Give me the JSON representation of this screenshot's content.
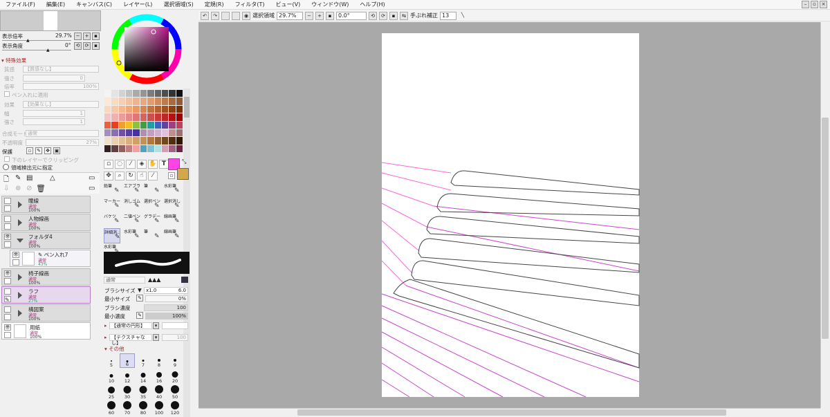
{
  "menu": [
    "ファイル(F)",
    "編集(E)",
    "キャンバス(C)",
    "レイヤー(L)",
    "選択領域(S)",
    "定規(R)",
    "フィルタ(T)",
    "ビュー(V)",
    "ウィンドウ(W)",
    "ヘルプ(H)"
  ],
  "toolbar": {
    "selection_label": "選択領域",
    "zoom": "29.7%",
    "angle": "0.0°",
    "stabilizer_label": "手ぶれ補正",
    "stabilizer_value": "13"
  },
  "view": {
    "zoom_label": "表示倍率",
    "zoom_value": "29.7%",
    "angle_label": "表示角度",
    "angle_value": "0°"
  },
  "effects": {
    "header": "特殊効果",
    "texture_label": "質感",
    "texture_value": "【質感なし】",
    "strength_label": "強さ",
    "strength_value": "0",
    "scale_label": "倍率",
    "scale_value": "100%",
    "apply_pen": "ペン入れに適用",
    "effect_label": "効果",
    "effect_value": "【効果なし】",
    "width_label": "幅",
    "width_value": "1",
    "strength2_label": "強さ",
    "strength2_value": "1"
  },
  "blend": {
    "mode_label": "合成モード",
    "mode_value": "通常",
    "opacity_label": "不透明度",
    "opacity_value": "27%"
  },
  "protect": {
    "label": "保護",
    "clip_label": "下のレイヤーでクリッピング",
    "detect_label": "領域検出元に指定"
  },
  "layers": [
    {
      "name": "瞳線",
      "mode": "通常",
      "opacity": "100%"
    },
    {
      "name": "人物線画",
      "mode": "通常",
      "opacity": "100%"
    },
    {
      "name": "フォルダ4",
      "mode": "通常",
      "opacity": "100%"
    },
    {
      "name": "ペン入れ7",
      "mode": "通常",
      "opacity": "43%"
    },
    {
      "name": "椅子線画",
      "mode": "通常",
      "opacity": "100%"
    },
    {
      "name": "ラフ",
      "mode": "通常",
      "opacity": "27%"
    },
    {
      "name": "構図案",
      "mode": "通常",
      "opacity": "100%"
    },
    {
      "name": "用紙",
      "mode": "通常",
      "opacity": "100%"
    }
  ],
  "colors": {
    "accent_pink": "#ff44e6",
    "secondary": "#d4a84a",
    "canvas_bg": "#a9a9a9"
  },
  "brushes": [
    [
      "鉛筆",
      "エアブラシ",
      "筆",
      "水彩筆"
    ],
    [
      "マーカー",
      "消しゴム",
      "選択ペン",
      "選択消し"
    ],
    [
      "バケツ",
      "二値ペン",
      "グラデーション",
      "線画筆"
    ],
    [
      "詳細消…",
      "水彩筆",
      "筆",
      "線画筆"
    ],
    [
      "水彩筆",
      "",
      "",
      ""
    ]
  ],
  "brush_settings": {
    "mode_value": "通常",
    "size_label": "ブラシサイズ",
    "size_mult": "x1.0",
    "size_value": "6.0",
    "min_size_label": "最小サイズ",
    "min_size_value": "0%",
    "density_label": "ブラシ濃度",
    "density_value": "100",
    "min_density_label": "最小濃度",
    "min_density_value": "100%",
    "shape_value": "【通常の円形】",
    "texture_value": "【テクスチャなし】",
    "texture_strength": "100",
    "other_label": "その他"
  },
  "dot_sizes": [
    "5",
    "6",
    "7",
    "8",
    "9",
    "10",
    "12",
    "14",
    "16",
    "20",
    "25",
    "30",
    "35",
    "40",
    "50",
    "60",
    "70",
    "80",
    "100",
    "120"
  ]
}
